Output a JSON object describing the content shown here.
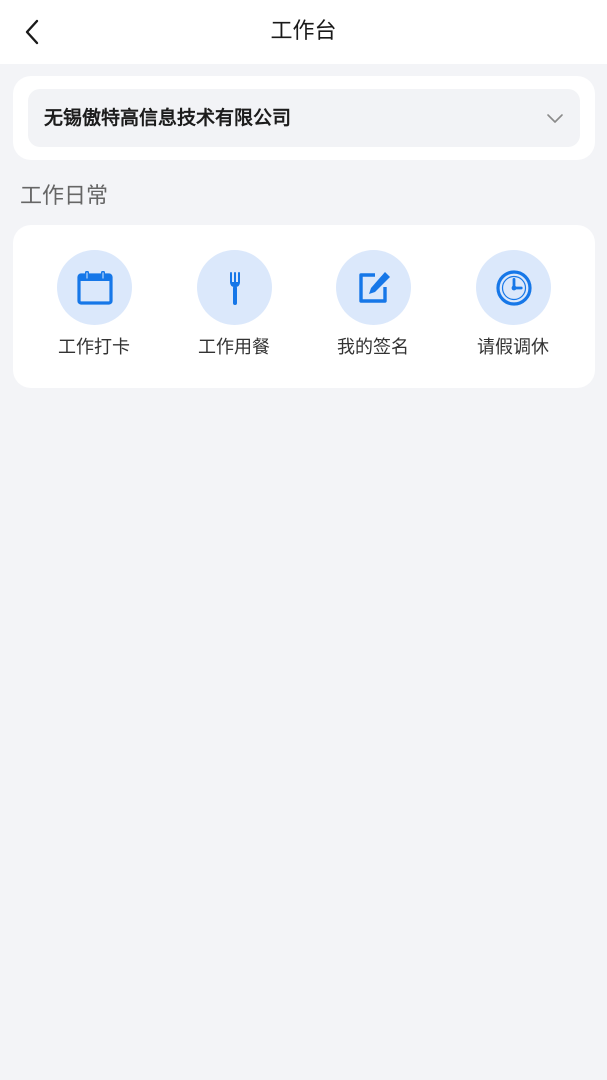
{
  "header": {
    "title": "工作台"
  },
  "company": {
    "selected": "无锡傲特高信息技术有限公司"
  },
  "section": {
    "title": "工作日常"
  },
  "tools": [
    {
      "label": "工作打卡",
      "icon": "calendar-icon"
    },
    {
      "label": "工作用餐",
      "icon": "fork-icon"
    },
    {
      "label": "我的签名",
      "icon": "edit-icon"
    },
    {
      "label": "请假调休",
      "icon": "clock-icon"
    }
  ],
  "colors": {
    "accent": "#1677e8",
    "icon_bg": "#dbe8fb",
    "page_bg": "#f3f4f7"
  }
}
